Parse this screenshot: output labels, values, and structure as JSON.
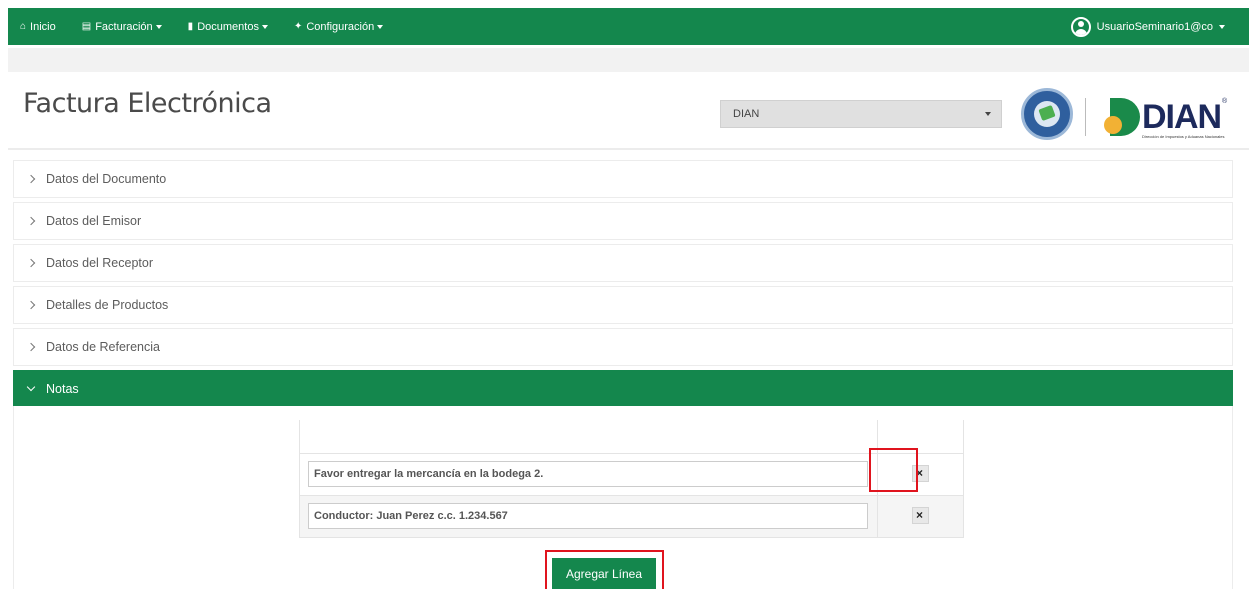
{
  "navbar": {
    "items": [
      {
        "label": "Inicio",
        "icon": "home-icon"
      },
      {
        "label": "Facturación",
        "icon": "invoice-icon"
      },
      {
        "label": "Documentos",
        "icon": "document-icon"
      },
      {
        "label": "Configuración",
        "icon": "wrench-icon"
      }
    ],
    "user": "UsuarioSeminario1@co"
  },
  "header": {
    "title": "Factura Electrónica",
    "select_value": "DIAN",
    "logo_text": "DIAN",
    "logo_subtitle": "Dirección de Impuestos y Aduanas Nacionales"
  },
  "accordion": {
    "items": [
      {
        "label": "Datos del Documento"
      },
      {
        "label": "Datos del Emisor"
      },
      {
        "label": "Datos del Receptor"
      },
      {
        "label": "Detalles de Productos"
      },
      {
        "label": "Datos de Referencia"
      },
      {
        "label": "Notas"
      }
    ]
  },
  "notes": {
    "rows": [
      {
        "value": "Favor entregar la mercancía en la bodega 2.",
        "delete_symbol": "×"
      },
      {
        "value": "Conductor: Juan Perez c.c. 1.234.567",
        "delete_symbol": "×"
      }
    ],
    "add_label": "Agregar Línea"
  },
  "colors": {
    "brand_green": "#14874d",
    "highlight_red": "#e0141e"
  }
}
